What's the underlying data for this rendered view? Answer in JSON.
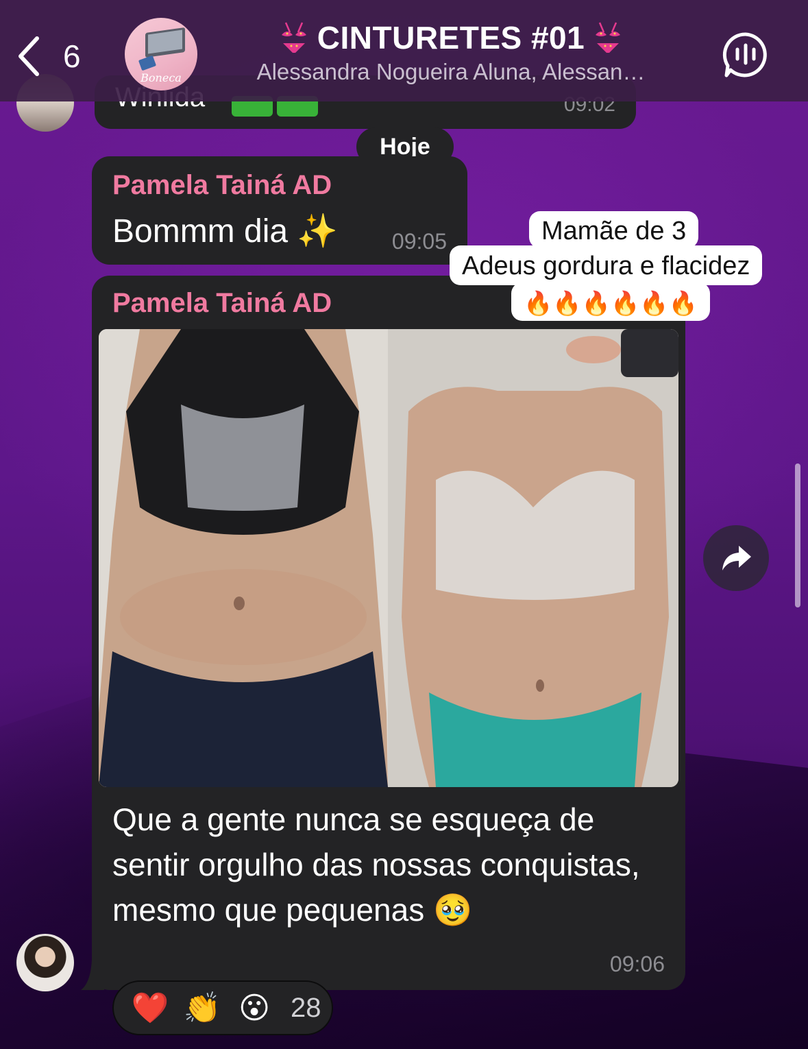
{
  "header": {
    "back_count": "6",
    "title": "CINTURETES #01",
    "subtitle": "Alessandra Nogueira Aluna, Alessan…",
    "avatar_brand": "Boneca"
  },
  "previous_message": {
    "text": "Winlida",
    "time": "09:02"
  },
  "date_separator": "Hoje",
  "messages": [
    {
      "sender": "Pamela Tainá AD",
      "text": "Bommm dia ✨",
      "time": "09:05"
    },
    {
      "sender": "Pamela Tainá AD",
      "caption": "Que a gente nunca se esqueça de sentir orgulho das nossas conquistas, mesmo que pequenas 🥹",
      "time": "09:06",
      "photo_overlay": {
        "line1": "Mamãe de 3",
        "line2": "Adeus gordura e flacidez",
        "line3": "🔥🔥🔥🔥🔥🔥"
      }
    }
  ],
  "reactions": {
    "emojis": [
      "❤️",
      "👏",
      "😮"
    ],
    "count": "28"
  },
  "colors": {
    "header_bg": "#3c1e46",
    "bubble_bg": "#232325",
    "sender_name": "#f07aa0",
    "wallpaper": "#5e178a"
  }
}
